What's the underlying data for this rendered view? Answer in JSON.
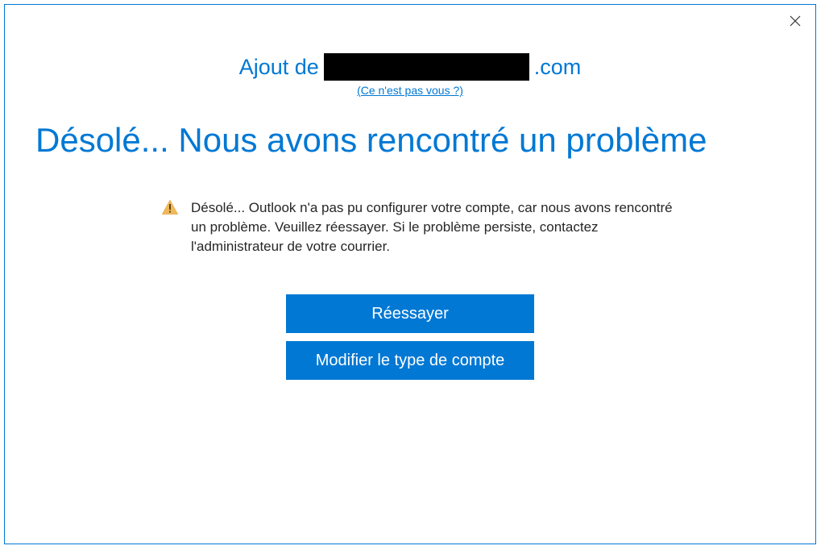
{
  "header": {
    "prefix": "Ajout de",
    "suffix": ".com",
    "not_you_link": "(Ce n'est pas vous ?)"
  },
  "main_heading": "Désolé... Nous avons rencontré un problème",
  "message": "Désolé... Outlook n'a pas pu configurer votre compte, car nous avons rencontré un problème. Veuillez réessayer. Si le problème persiste, contactez l'administrateur de votre courrier.",
  "buttons": {
    "retry": "Réessayer",
    "change_account_type": "Modifier le type de compte"
  }
}
